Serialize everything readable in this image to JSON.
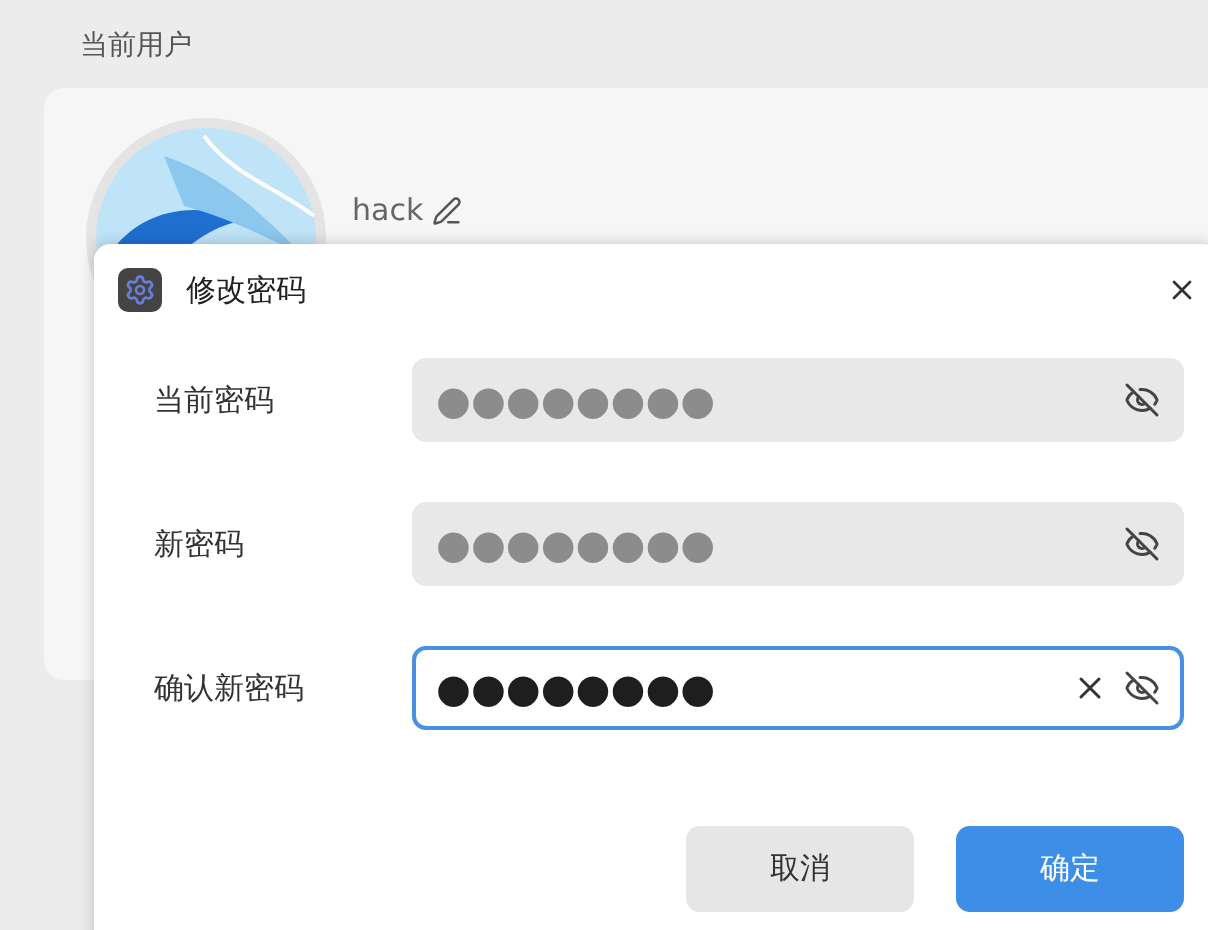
{
  "page": {
    "section_title": "当前用户",
    "user_name": "hack"
  },
  "dialog": {
    "title": "修改密码",
    "fields": [
      {
        "label": "当前密码",
        "value": "●●●●●●●●",
        "focused": false
      },
      {
        "label": "新密码",
        "value": "●●●●●●●●",
        "focused": false
      },
      {
        "label": "确认新密码",
        "value": "●●●●●●●●",
        "focused": true
      }
    ],
    "buttons": [
      {
        "label": "取消",
        "kind": "secondary"
      },
      {
        "label": "确定",
        "kind": "primary"
      }
    ]
  }
}
